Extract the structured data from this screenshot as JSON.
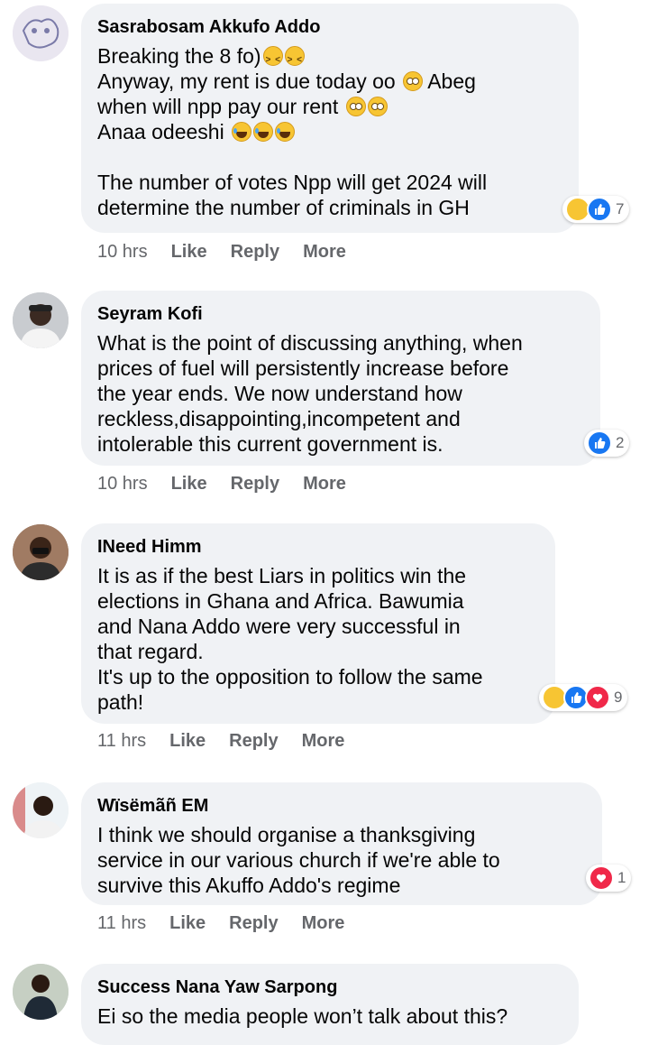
{
  "comments": [
    {
      "author": "Sasrabosam Akkufo Addo",
      "lines": [
        "Breaking the 8 fo)",
        "Anyway, my rent is due today oo",
        "when will npp pay our rent",
        "Anaa odeeshi",
        "",
        "The number of votes Npp will get 2024 will",
        "determine the number of criminals in GH"
      ],
      "line_suffix": [
        "",
        "Abeg",
        "",
        "",
        "",
        "",
        ""
      ],
      "reaction_count": "7",
      "time": "10 hrs"
    },
    {
      "author": "Seyram Kofi",
      "lines": [
        "What is the point of discussing anything, when",
        "prices of fuel will persistently increase before",
        "the year ends. We now understand how",
        "reckless,disappointing,incompetent and",
        "intolerable this current government is."
      ],
      "reaction_count": "2",
      "time": "10 hrs"
    },
    {
      "author": "INeed Himm",
      "lines": [
        "It is as if the best Liars in politics win the",
        "elections in Ghana and Africa. Bawumia",
        "and Nana Addo were very successful in",
        "that regard.",
        "It's up to the opposition to follow the same",
        "path!"
      ],
      "reaction_count": "9",
      "time": "11 hrs"
    },
    {
      "author": "Wïsëmãñ EM",
      "lines": [
        "I think we should organise a thanksgiving",
        "service in our various church if we're able to",
        "survive this Akuffo Addo's regime"
      ],
      "reaction_count": "1",
      "time": "11 hrs"
    },
    {
      "author": "Success Nana Yaw Sarpong",
      "lines": [
        "Ei so the media people won’t talk about this?"
      ]
    }
  ],
  "actions": {
    "like": "Like",
    "reply": "Reply",
    "more": "More"
  },
  "colors": {
    "bubble": "#f0f2f5",
    "meta": "#65676b",
    "like": "#1877f2",
    "love": "#f02849",
    "haha": "#f7c533"
  }
}
